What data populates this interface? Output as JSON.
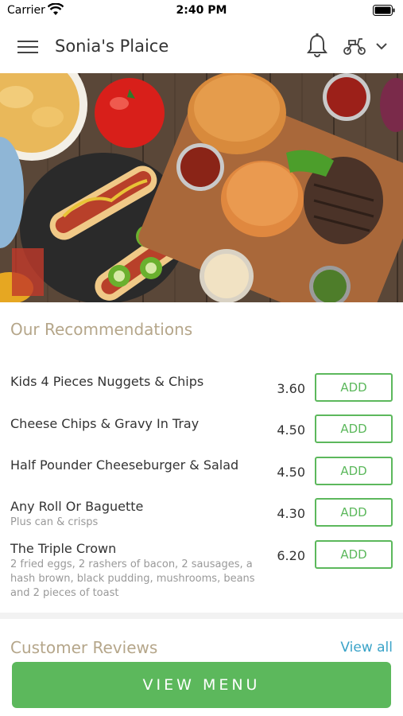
{
  "status_bar": {
    "carrier": "Carrier",
    "time": "2:40 PM"
  },
  "header": {
    "title": "Sonia's Plaice"
  },
  "hero": {
    "image": "food-spread: hot dogs, burgers, chips, sauces"
  },
  "recommendations": {
    "title": "Our Recommendations",
    "items": [
      {
        "name": "Kids 4 Pieces Nuggets & Chips",
        "description": "",
        "price": "3.60",
        "add_label": "ADD"
      },
      {
        "name": "Cheese Chips & Gravy In Tray",
        "description": "",
        "price": "4.50",
        "add_label": "ADD"
      },
      {
        "name": "Half Pounder Cheeseburger & Salad",
        "description": "",
        "price": "4.50",
        "add_label": "ADD"
      },
      {
        "name": "Any Roll Or Baguette",
        "description": "Plus can & crisps",
        "price": "4.30",
        "add_label": "ADD"
      },
      {
        "name": "The Triple Crown",
        "description": "2 fried eggs, 2 rashers of bacon, 2 sausages, a hash brown, black pudding, mushrooms, beans and 2 pieces of toast",
        "price": "6.20",
        "add_label": "ADD"
      }
    ]
  },
  "reviews": {
    "title": "Customer Reviews",
    "view_all_label": "View all"
  },
  "footer": {
    "view_menu_label": "VIEW MENU"
  },
  "colors": {
    "accent_green": "#5cb85c",
    "section_title": "#b5a68a",
    "link_blue": "#3aa3c8"
  }
}
